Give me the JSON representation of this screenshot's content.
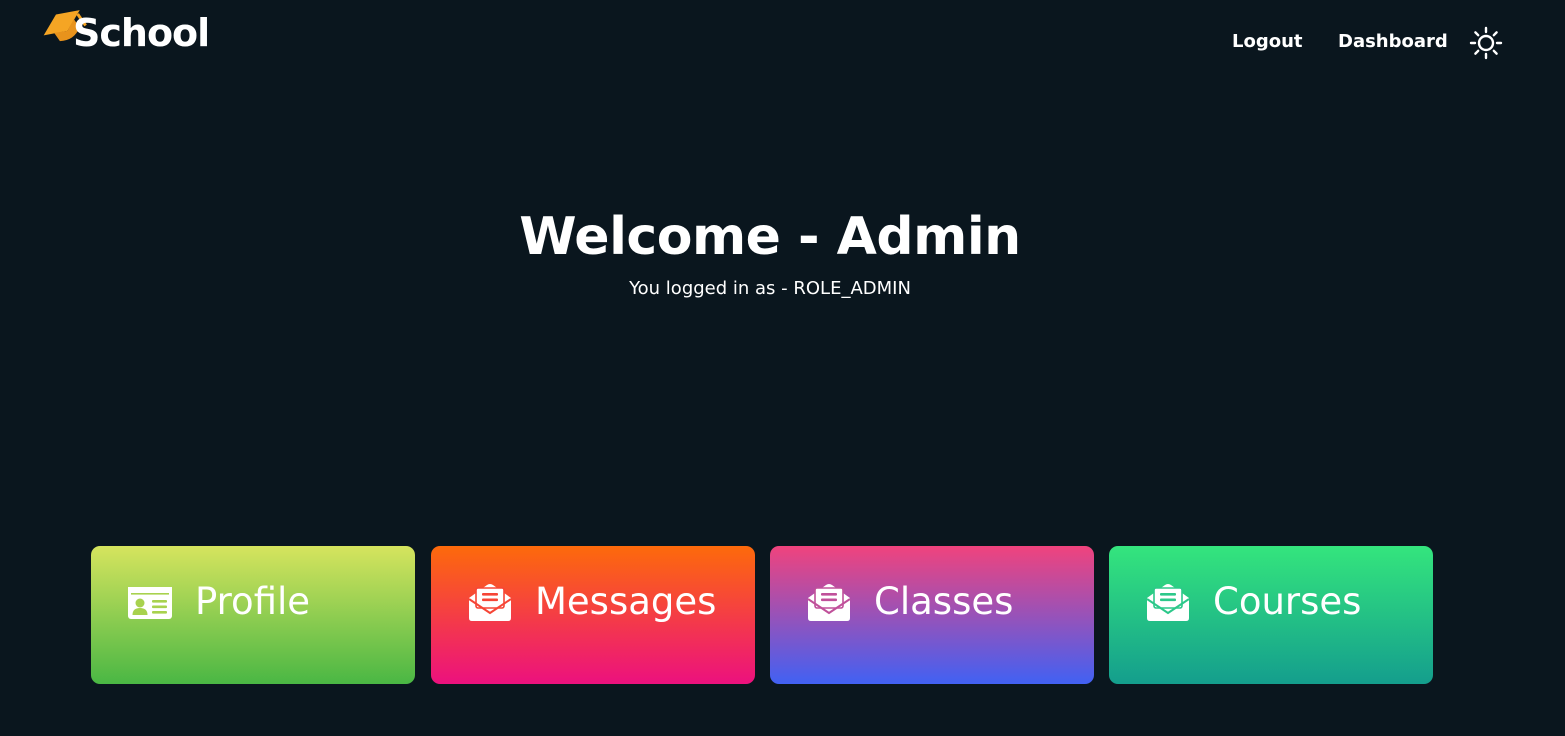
{
  "header": {
    "logo_text": "School",
    "nav": {
      "logout_label": "Logout",
      "dashboard_label": "Dashboard"
    },
    "theme_toggle_icon": "sun-icon"
  },
  "hero": {
    "title": "Welcome - Admin",
    "subtitle": "You logged in as - ROLE_ADMIN"
  },
  "cards": [
    {
      "label": "Profile",
      "icon": "id-card-icon",
      "gradient": [
        "#d6e45e",
        "#4ab744"
      ]
    },
    {
      "label": "Messages",
      "icon": "envelope-open-text-icon",
      "gradient": [
        "#fd6a0b",
        "#ec117e"
      ]
    },
    {
      "label": "Classes",
      "icon": "envelope-open-text-icon",
      "gradient": [
        "#f0437d",
        "#4161f3"
      ]
    },
    {
      "label": "Courses",
      "icon": "envelope-open-text-icon",
      "gradient": [
        "#34e57d",
        "#149e8d"
      ]
    }
  ],
  "colors": {
    "background": "#0a161e",
    "logo_accent": "#f5a524",
    "text": "#ffffff"
  }
}
